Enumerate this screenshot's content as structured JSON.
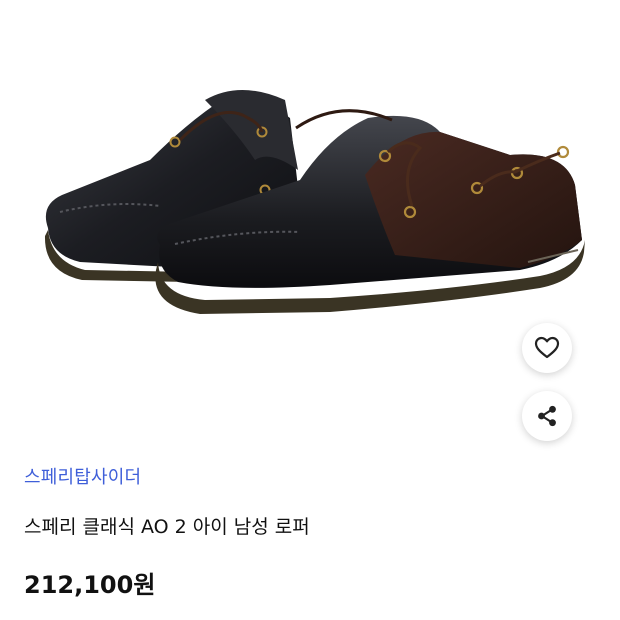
{
  "product": {
    "brand": "스페리탑사이더",
    "name": "스페리 클래식 AO 2 아이 남성 로퍼",
    "price": "212,100원",
    "image_alt": "Sperry Authentic Original 2-Eye boat shoes, black leather with brown accents"
  },
  "actions": {
    "wishlist_icon": "heart-outline-icon",
    "share_icon": "share-icon"
  },
  "colors": {
    "brand_link": "#3f5fd9",
    "text": "#111111",
    "background": "#ffffff"
  }
}
